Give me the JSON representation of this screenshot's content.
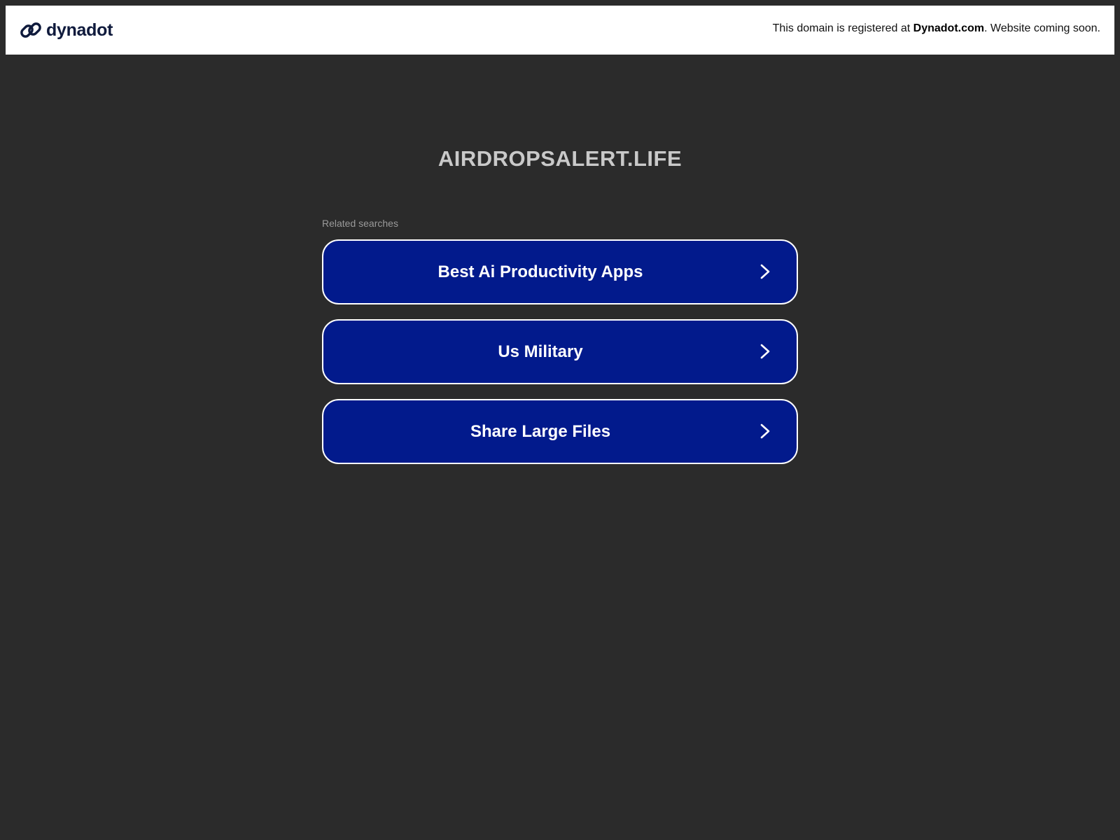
{
  "header": {
    "brand_name": "dynadot",
    "brand_icon": "link-icon",
    "notice_prefix": "This domain is registered at ",
    "notice_link": "Dynadot.com",
    "notice_suffix": ". Website coming soon."
  },
  "main": {
    "domain": "AIRDROPSALERT.LIFE",
    "related_label": "Related searches",
    "results": [
      {
        "label": "Best Ai Productivity Apps",
        "icon": "chevron-right-icon"
      },
      {
        "label": "Us Military",
        "icon": "chevron-right-icon"
      },
      {
        "label": "Share Large Files",
        "icon": "chevron-right-icon"
      }
    ]
  },
  "colors": {
    "page_background": "#2b2b2b",
    "header_background": "#ffffff",
    "brand_text": "#0f1a3c",
    "button_fill": "#021a8c",
    "button_border": "#ffffff",
    "title_text": "#c9c9c9",
    "label_text": "#9a9a9a"
  }
}
